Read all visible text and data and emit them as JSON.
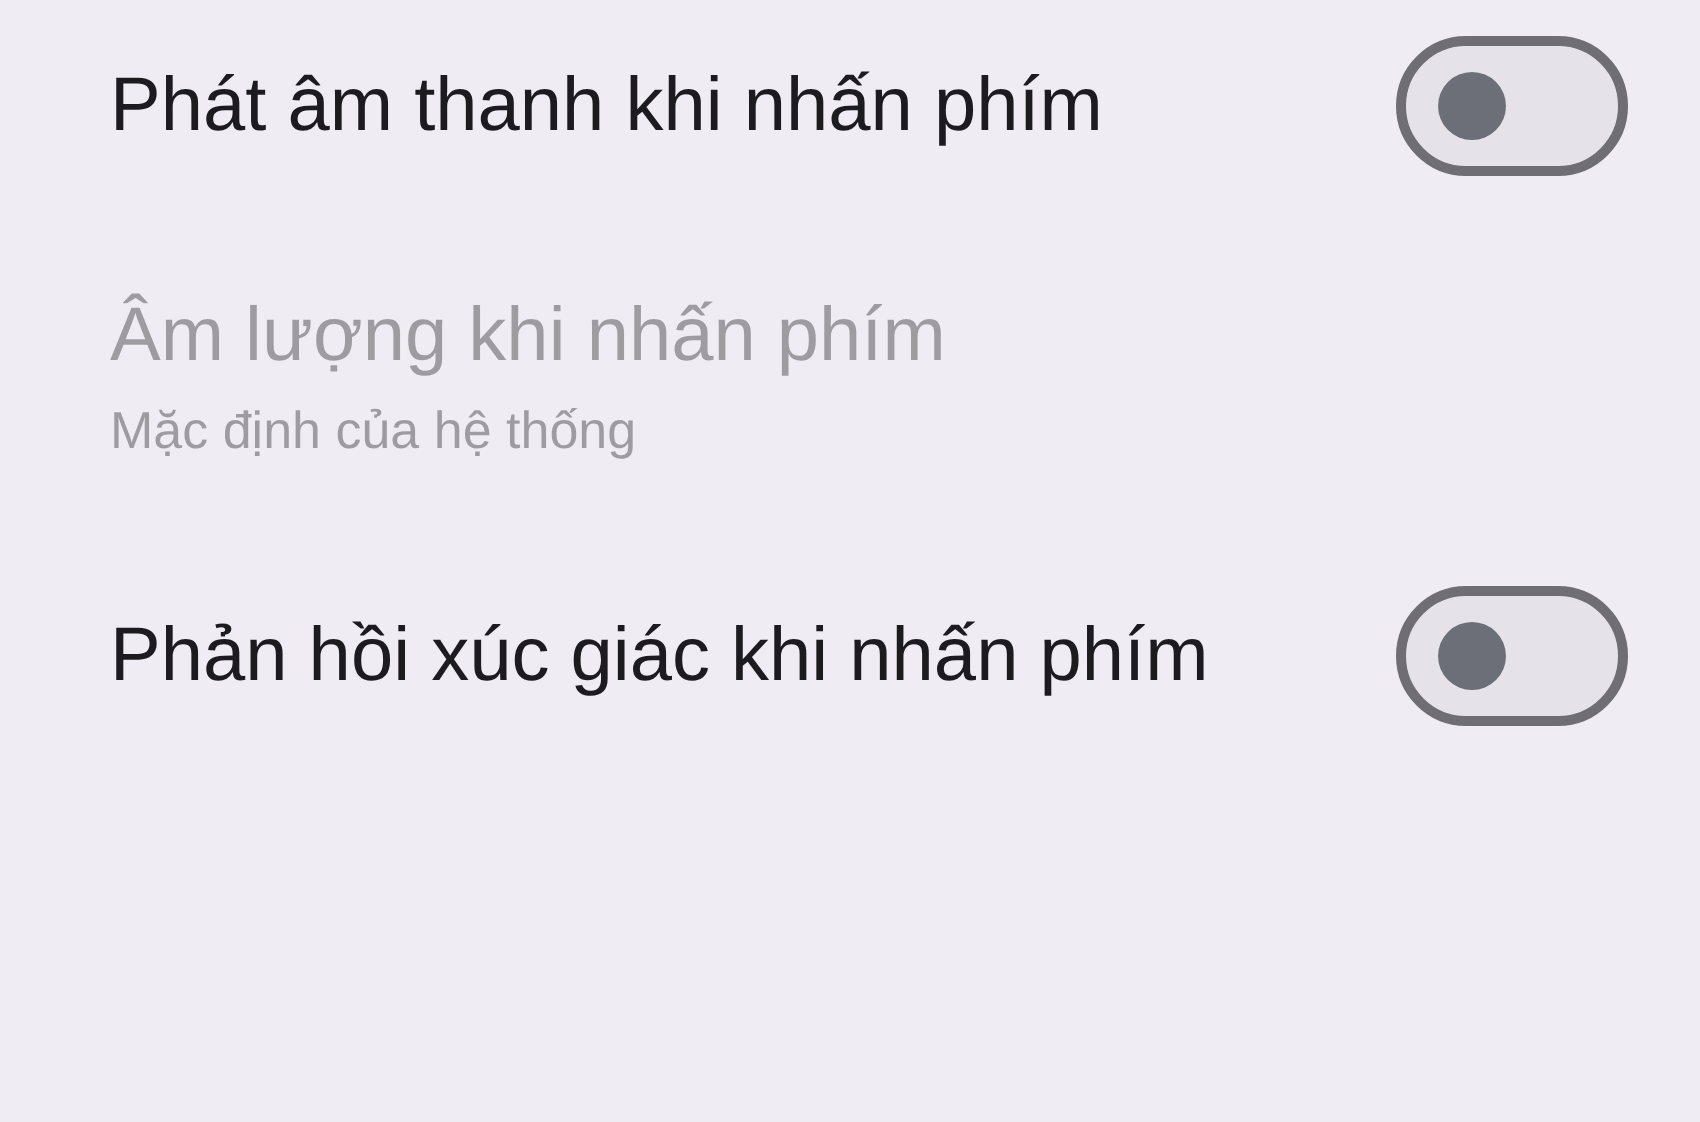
{
  "settings": [
    {
      "kind": "switch",
      "title": "Phát âm thanh khi nhấn phím",
      "on": false,
      "disabled": false
    },
    {
      "kind": "value",
      "title": "Âm lượng khi nhấn phím",
      "summary": "Mặc định của hệ thống",
      "disabled": true
    },
    {
      "kind": "switch",
      "title": "Phản hồi xúc giác khi nhấn phím",
      "on": false,
      "disabled": false
    }
  ]
}
